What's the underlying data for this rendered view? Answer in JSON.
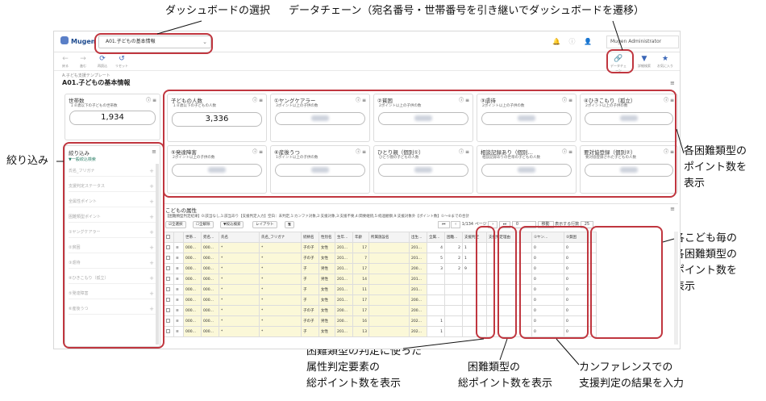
{
  "annotations": {
    "dashboard_select": "ダッシュボードの選択",
    "data_chain": "データチェーン（宛名番号・世帯番号を引き継いでダッシュボードを遷移）",
    "filter": "絞り込み",
    "difficulty_points_line1": "各困難類型の",
    "difficulty_points_line2": "ポイント数を",
    "difficulty_points_line3": "表示",
    "per_child_line1": "各こども毎の",
    "per_child_line2": "各困難類型の",
    "per_child_line3": "ポイント数を",
    "per_child_line4": "表示",
    "attr_points_line1": "困難類型の判定に使った",
    "attr_points_line2": "属性判定要素の",
    "attr_points_line3": "総ポイント数を表示",
    "type_points_line1": "困難類型の",
    "type_points_line2": "総ポイント数を表示",
    "conference_line1": "カンファレンスでの",
    "conference_line2": "支援判定の結果を入力"
  },
  "app": {
    "logo": "Mugen",
    "dashboard_value": "A01.子どもの基本情報",
    "user": "Mugen Administrator",
    "top_icons": "🔔 ⓘ 👤"
  },
  "toolbar": {
    "back": "戻る",
    "forward": "進む",
    "reload": "再読込",
    "reset": "リセット",
    "chain": "データチェーン",
    "detail_search": "詳細検索",
    "favorite": "お気に入り"
  },
  "breadcrumb": "A.子ども支援テンプレート",
  "page_title": "A01.子どもの基本情報",
  "cards": [
    {
      "title": "世帯数",
      "sub": "１８歳以下の子どもの世帯数",
      "value": "1,934"
    },
    {
      "title": "子どもの人数",
      "sub": "１８歳以下の子どもの人数",
      "value": "3,336"
    },
    {
      "title": "①ヤングケアラー",
      "sub": "3ポイント以上の子供の数",
      "value": ""
    },
    {
      "title": "②貧困",
      "sub": "2ポイント以上の子供の数",
      "value": ""
    },
    {
      "title": "③虐待",
      "sub": "2ポイント以上の子供の数",
      "value": ""
    },
    {
      "title": "④ひきこもり（孤立）",
      "sub": "2ポイント以上の子供の数",
      "value": ""
    },
    {
      "title": "⑤発達障害",
      "sub": "2ポイント以上の子供の数",
      "value": ""
    },
    {
      "title": "⑥産後うつ",
      "sub": "1ポイント以上の子供の数",
      "value": ""
    },
    {
      "title": "ひとり親（個別①）",
      "sub": "ひとり親の子どもの人数",
      "value": ""
    },
    {
      "title": "相談記録あり（個別…",
      "sub": "相談記録ありの世帯の子どもの人数",
      "value": ""
    },
    {
      "title": "要対協登録（個別②）",
      "sub": "要対協登録された子どもの人数",
      "value": ""
    }
  ],
  "filter": {
    "title": "絞り込み",
    "search": "▼一般絞込検索",
    "items": [
      "氏名_フリガナ",
      "支援判定ステータス",
      "全属性ポイント",
      "困難類型ポイント",
      "①ヤングケアラー",
      "②貧困",
      "③虐待",
      "④ひきこもり（孤立）",
      "⑤発達障害",
      "⑥産後うつ"
    ]
  },
  "attr": {
    "title": "こどもの属性",
    "legend": "【困難類型判定結果】0:該当なし,1:該当あり【支援判定入力】空白：未判定,1:カンファ対象,2:支援対象,3:支援不要,4:関要継続,5:経過観察,9:支援対象外【ポイント数】①～⑥までの合計",
    "buttons": [
      "☑全選択",
      "☐全解除",
      "▼絞込検索",
      "レイアウト",
      "🖫"
    ],
    "page_info": "1/134 ページ",
    "page_input": "0",
    "move": "移動",
    "rows_label": "表示する行数",
    "rows_value": "25",
    "columns": [
      "",
      "",
      "世帯…",
      "宛名…",
      "氏名",
      "氏名_フリガナ",
      "続柄名",
      "性別名",
      "生年…",
      "年齢",
      "所属施設名",
      "出生…",
      "全属…",
      "困難…",
      "支援判定",
      "支援判定理由",
      "①ヤン…",
      "②貧困"
    ],
    "rows": [
      [
        "000…",
        "000…",
        "*",
        "*",
        "子の子",
        "女性",
        "201…",
        "17",
        "",
        "201…",
        "4",
        "2",
        "1",
        "",
        "0",
        "0"
      ],
      [
        "000…",
        "000…",
        "*",
        "*",
        "子の子",
        "女性",
        "201…",
        "7",
        "",
        "201…",
        "5",
        "2",
        "1",
        "",
        "0",
        "0"
      ],
      [
        "000…",
        "000…",
        "*",
        "*",
        "子",
        "男性",
        "201…",
        "17",
        "",
        "200…",
        "3",
        "2",
        "9",
        "",
        "0",
        "0"
      ],
      [
        "000…",
        "000…",
        "*",
        "*",
        "子",
        "男性",
        "201…",
        "14",
        "",
        "201…",
        "",
        "",
        "",
        "",
        "0",
        "0"
      ],
      [
        "000…",
        "000…",
        "*",
        "*",
        "子",
        "女性",
        "201…",
        "11",
        "",
        "201…",
        "",
        "",
        "",
        "",
        "0",
        "0"
      ],
      [
        "000…",
        "000…",
        "*",
        "*",
        "子",
        "女性",
        "201…",
        "17",
        "",
        "200…",
        "",
        "",
        "",
        "",
        "0",
        "0"
      ],
      [
        "000…",
        "000…",
        "*",
        "*",
        "子の子",
        "女性",
        "200…",
        "17",
        "",
        "200…",
        "",
        "",
        "",
        "",
        "0",
        "0"
      ],
      [
        "000…",
        "000…",
        "*",
        "*",
        "子の子",
        "男性",
        "200…",
        "16",
        "",
        "202…",
        "1",
        "",
        "",
        "",
        "0",
        "0"
      ],
      [
        "000…",
        "000…",
        "*",
        "*",
        "子",
        "女性",
        "201…",
        "13",
        "",
        "202…",
        "1",
        "",
        "",
        "",
        "0",
        "0"
      ]
    ]
  }
}
